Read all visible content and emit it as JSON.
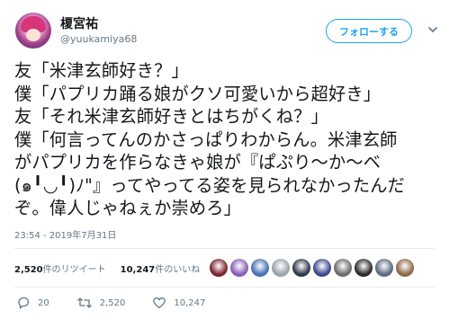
{
  "user": {
    "display_name": "榎宮祐",
    "handle": "@yuukamiya68"
  },
  "follow_button": "フォローする",
  "tweet": {
    "lines": [
      "友「米津玄師好き？」",
      "僕「パプリカ踊る娘がクソ可愛いから超好き」",
      "友「それ米津玄師好きとはちがくね？」",
      "僕「何言ってんのかさっぱりわからん。米津玄師",
      "がパプリカを作らなきゃ娘が『ぱぷり〜か〜ベ",
      "(๑╹◡╹)ﾉ\"』ってやってる姿を見られなかったんだ",
      "ぞ。偉人じゃねぇか崇めろ」"
    ],
    "timestamp": "23:54 - 2019年7月31日"
  },
  "stats": {
    "retweets_count": "2,520",
    "retweets_label": "件のリツイート",
    "likes_count": "10,247",
    "likes_label": "件のいいね"
  },
  "likers": [
    "#7a2433",
    "#8a5fb8",
    "#4a72b3",
    "#9aa3ad",
    "#2f3a4a",
    "#3e4a8e",
    "#6c6c6c",
    "#2b2b2b",
    "#5d6a80",
    "#8c6a4a"
  ],
  "actions": {
    "reply_count": "20",
    "retweet_count": "2,520",
    "like_count": "10,247"
  },
  "colors": {
    "accent": "#1da1f2",
    "secondary_text": "#657786"
  },
  "icons": {
    "reply": "reply-icon",
    "retweet": "retweet-icon",
    "like": "heart-icon",
    "more": "chevron-down-icon"
  }
}
